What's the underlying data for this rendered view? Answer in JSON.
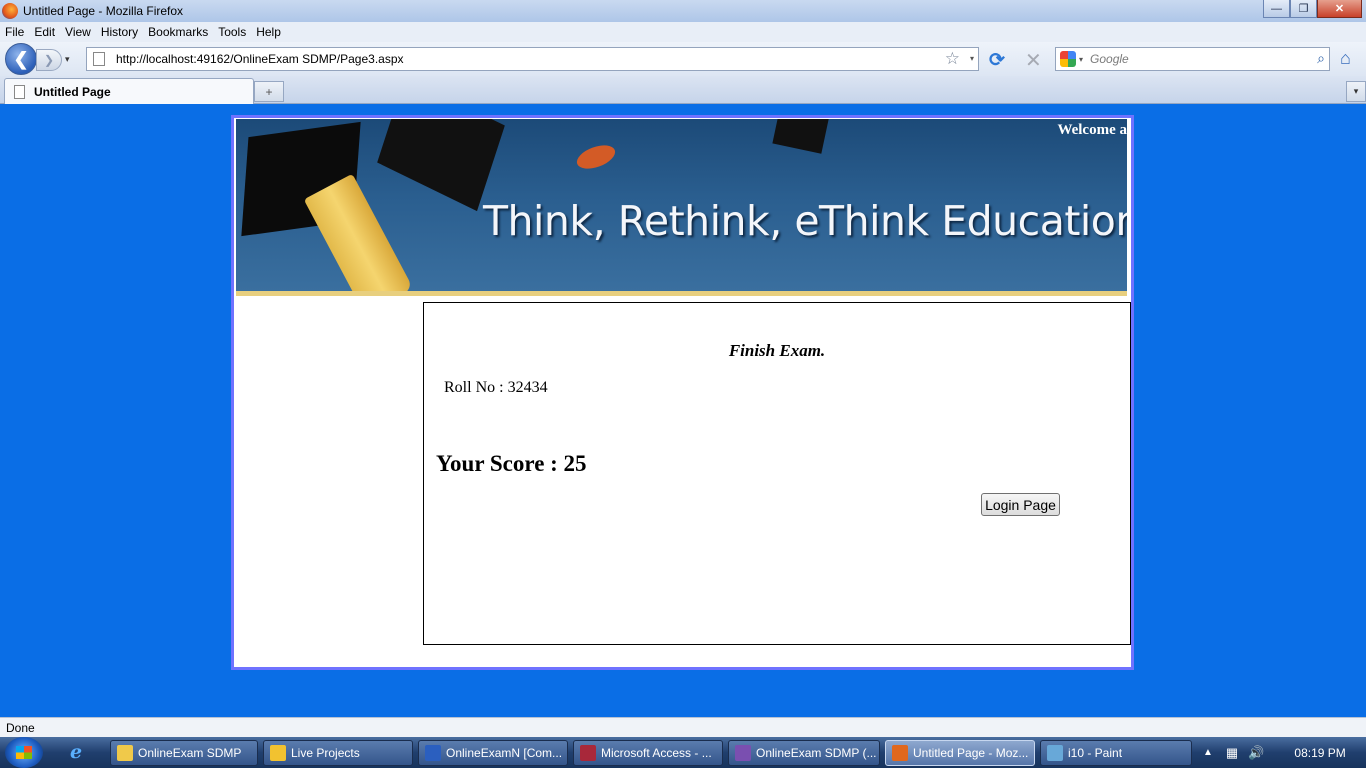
{
  "window": {
    "title": "Untitled Page - Mozilla Firefox",
    "controls": {
      "minimize": "—",
      "maximize": "❐",
      "close": "✕"
    }
  },
  "menu": {
    "items": [
      "File",
      "Edit",
      "View",
      "History",
      "Bookmarks",
      "Tools",
      "Help"
    ]
  },
  "navbar": {
    "back": "❮",
    "forward": "❯",
    "history_dropdown": "▾",
    "url": "http://localhost:49162/OnlineExam SDMP/Page3.aspx",
    "bookmark_star": "☆",
    "url_dropdown": "▾",
    "reload": "⟳",
    "stop": "✕",
    "search_dropdown": "▾",
    "search_placeholder": "Google",
    "search_icon": "⌕",
    "home": "⌂"
  },
  "tabs": {
    "items": [
      {
        "label": "Untitled Page"
      }
    ],
    "new_tab": "+",
    "tab_list": "▾"
  },
  "page": {
    "banner": {
      "welcome": "Welcome a",
      "slogan": "Think, Rethink, eThink Education"
    },
    "heading": "Finish Exam.",
    "roll_no": "Roll No : 32434",
    "score": "Your Score : 25",
    "login_button": "Login Page"
  },
  "status": {
    "text": "Done"
  },
  "taskbar": {
    "tasks": [
      {
        "label": "OnlineExam SDMP",
        "icon": "folder-icon",
        "color": "#f0c94a"
      },
      {
        "label": "Live Projects",
        "icon": "star-icon",
        "color": "#f2c230"
      },
      {
        "label": "OnlineExamN [Com...",
        "icon": "word-icon",
        "color": "#2b5fbf"
      },
      {
        "label": "Microsoft Access - ...",
        "icon": "access-icon",
        "color": "#a8283a"
      },
      {
        "label": "OnlineExam SDMP (...",
        "icon": "visual-studio-icon",
        "color": "#7a4fb0"
      },
      {
        "label": "Untitled Page - Moz...",
        "icon": "firefox-icon",
        "color": "#e0681e"
      },
      {
        "label": "i10 - Paint",
        "icon": "paint-icon",
        "color": "#68a8d8"
      }
    ],
    "clock": "08:19 PM"
  }
}
